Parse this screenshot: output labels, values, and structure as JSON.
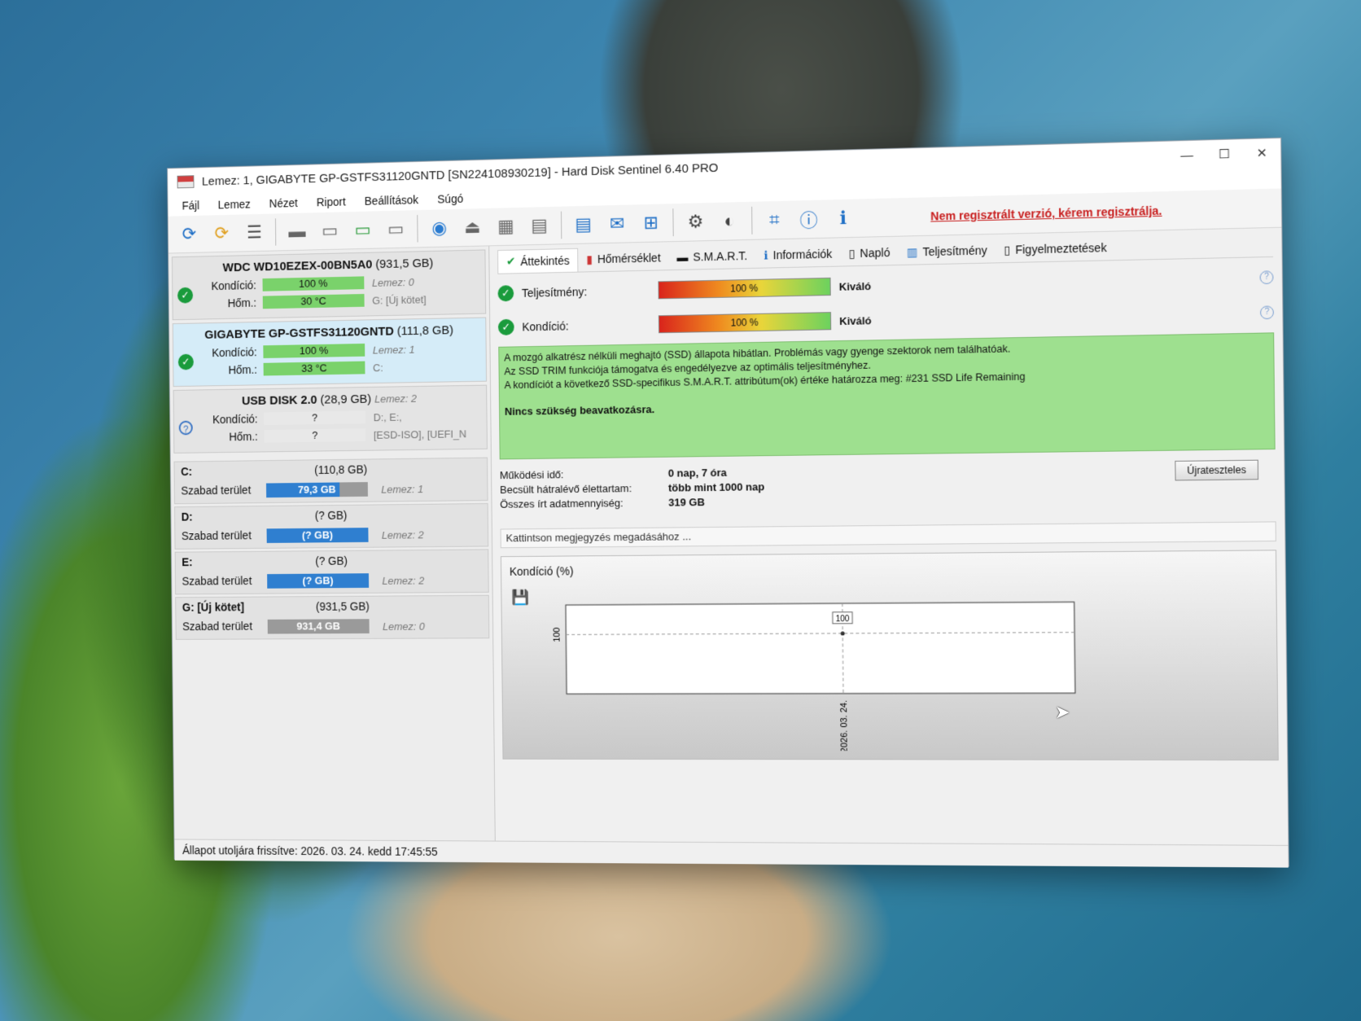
{
  "window": {
    "title": "Lemez: 1, GIGABYTE GP-GSTFS31120GNTD [SN224108930219]  -  Hard Disk Sentinel 6.40 PRO",
    "minimize": "—",
    "maximize": "☐",
    "close": "✕"
  },
  "menu": [
    "Fájl",
    "Lemez",
    "Nézet",
    "Riport",
    "Beállítások",
    "Súgó"
  ],
  "toolbar": {
    "unregistered": "Nem regisztrált verzió, kérem regisztrálja."
  },
  "disks": [
    {
      "name": "WDC WD10EZEX-00BN5A0",
      "size": "(931,5 GB)",
      "cond_label": "Kondíció:",
      "cond": "100 %",
      "cond_level": 100,
      "cond_extra": "Lemez: 0",
      "temp_label": "Hőm.:",
      "temp": "30 °C",
      "temp_extra": "G: [Új kötet]"
    },
    {
      "name": "GIGABYTE GP-GSTFS31120GNTD",
      "size": "(111,8 GB)",
      "cond_label": "Kondíció:",
      "cond": "100 %",
      "cond_level": 100,
      "cond_extra": "Lemez: 1",
      "temp_label": "Hőm.:",
      "temp": "33 °C",
      "temp_extra": "C:"
    },
    {
      "name": "USB DISK 2.0",
      "size": "(28,9 GB)",
      "disk_no": "Lemez: 2",
      "cond_label": "Kondíció:",
      "cond": "?",
      "cond_level": 0,
      "cond_extra": "D:, E:,",
      "temp_label": "Hőm.:",
      "temp": "?",
      "temp_extra": "[ESD-ISO], [UEFI_N"
    }
  ],
  "volumes": [
    {
      "name": "C:",
      "size": "(110,8 GB)",
      "free_label": "Szabad terület",
      "free": "79,3 GB",
      "free_level": 72,
      "disk": "Lemez: 1"
    },
    {
      "name": "D:",
      "size": "(? GB)",
      "free_label": "Szabad terület",
      "free": "(? GB)",
      "free_level": 100,
      "disk": "Lemez: 2"
    },
    {
      "name": "E:",
      "size": "(? GB)",
      "free_label": "Szabad terület",
      "free": "(? GB)",
      "free_level": 100,
      "disk": "Lemez: 2"
    },
    {
      "name": "G: [Új kötet]",
      "size": "(931,5 GB)",
      "free_label": "Szabad terület",
      "free": "931,4 GB",
      "free_level": 0,
      "disk": "Lemez: 0"
    }
  ],
  "tabs": [
    "Áttekintés",
    "Hőmérséklet",
    "S.M.A.R.T.",
    "Információk",
    "Napló",
    "Teljesítmény",
    "Figyelmeztetések"
  ],
  "status": {
    "perf_label": "Teljesítmény:",
    "perf_value": "100 %",
    "perf_level": 100,
    "perf_word": "Kiváló",
    "cond_label": "Kondíció:",
    "cond_value": "100 %",
    "cond_level": 100,
    "cond_word": "Kiváló"
  },
  "message": {
    "line1": "A mozgó alkatrész nélküli meghajtó (SSD) állapota hibátlan. Problémás vagy gyenge szektorok nem találhatóak.",
    "line2": "Az SSD TRIM funkciója támogatva és engedélyezve az optimális teljesítményhez.",
    "line3": "A kondíciót a következő SSD-specifikus S.M.A.R.T. attribútum(ok) értéke határozza meg:  #231 SSD Life Remaining",
    "line4": "Nincs szükség beavatkozásra."
  },
  "info": {
    "uptime_label": "Működési idő:",
    "uptime": "0 nap, 7 óra",
    "remaining_label": "Becsült hátralévő élettartam:",
    "remaining": "több mint 1000 nap",
    "written_label": "Összes írt adatmennyiség:",
    "written": "319 GB",
    "reset": "Újrateszteles"
  },
  "note_placeholder": "Kattintson megjegyzés megadásához ...",
  "chart_data": {
    "type": "line",
    "title": "Kondíció  (%)",
    "x": [
      "2026. 03. 24."
    ],
    "series": [
      {
        "values": [
          100
        ]
      }
    ],
    "data_labels": [
      "100"
    ],
    "y_tick": "100",
    "x_tick": "2026. 03. 24."
  },
  "statusbar": "Állapot utoljára frissítve: 2026. 03. 24. kedd 17:45:55"
}
